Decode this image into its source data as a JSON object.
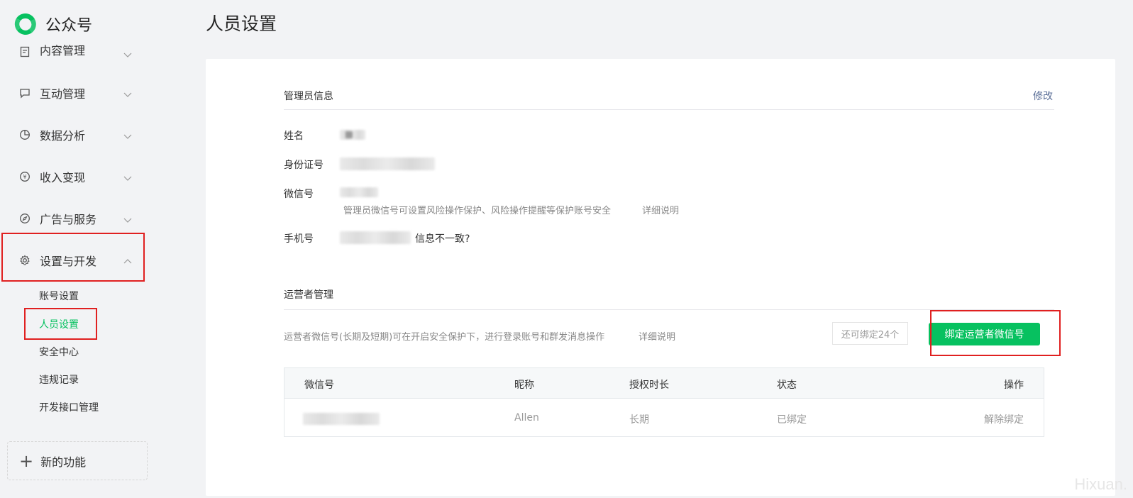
{
  "brand": {
    "name": "公众号",
    "accent": "#07c160"
  },
  "sidebar": {
    "items": [
      {
        "label": "内容管理",
        "icon": "document-icon",
        "expanded": false
      },
      {
        "label": "互动管理",
        "icon": "message-icon",
        "expanded": false
      },
      {
        "label": "数据分析",
        "icon": "pie-chart-icon",
        "expanded": false
      },
      {
        "label": "收入变现",
        "icon": "yen-icon",
        "expanded": false
      },
      {
        "label": "广告与服务",
        "icon": "compass-icon",
        "expanded": false
      },
      {
        "label": "设置与开发",
        "icon": "gear-icon",
        "expanded": true
      }
    ],
    "sub_items": [
      {
        "label": "账号设置",
        "active": false
      },
      {
        "label": "人员设置",
        "active": true
      },
      {
        "label": "安全中心",
        "active": false
      },
      {
        "label": "违规记录",
        "active": false
      },
      {
        "label": "开发接口管理",
        "active": false
      }
    ],
    "new_feature": "新的功能"
  },
  "page": {
    "title": "人员设置"
  },
  "admin": {
    "section_title": "管理员信息",
    "edit_link": "修改",
    "name_label": "姓名",
    "id_label": "身份证号",
    "wechat_label": "微信号",
    "wechat_hint": "管理员微信号可设置风险操作保护、风险操作提醒等保护账号安全",
    "wechat_hint_link": "详细说明",
    "phone_label": "手机号",
    "phone_link": "信息不一致?"
  },
  "operators": {
    "section_title": "运营者管理",
    "hint": "运营者微信号(长期及短期)可在开启安全保护下，进行登录账号和群发消息操作",
    "hint_link": "详细说明",
    "remaining": "还可绑定24个",
    "bind_button": "绑定运营者微信号",
    "columns": [
      "微信号",
      "昵称",
      "授权时长",
      "状态",
      "操作"
    ],
    "rows": [
      {
        "nickname": "Allen",
        "duration": "长期",
        "status": "已绑定",
        "action": "解除绑定"
      }
    ]
  },
  "watermark": "Hixuan."
}
